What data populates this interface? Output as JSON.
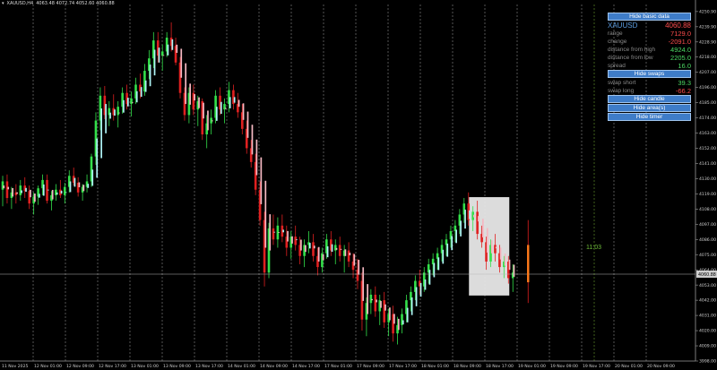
{
  "header": {
    "symbol": "XAUUSD,H4",
    "ohlc": "4063.48 4072.74 4052.60 4060.88"
  },
  "panel": {
    "hide_basic_data": "Hide basic data",
    "symbol": "XAUUSD",
    "price": "4060.88",
    "rows_basic": [
      {
        "label": "range",
        "value": "7129.0",
        "color": "#ff4d4d"
      },
      {
        "label": "change",
        "value": "-2091.0",
        "color": "#ff4d4d"
      },
      {
        "label": "distance from high",
        "value": "4924.0",
        "color": "#4cd964"
      },
      {
        "label": "distance from low",
        "value": "2205.0",
        "color": "#4cd964"
      },
      {
        "label": "spread",
        "value": "16.0",
        "color": "#4cd964"
      }
    ],
    "hide_swaps": "Hide swaps",
    "rows_swaps": [
      {
        "label": "swap short",
        "value": "39.3",
        "color": "#4cd964"
      },
      {
        "label": "swap long",
        "value": "-66.2",
        "color": "#ff4d4d"
      }
    ],
    "hide_candle": "Hide candle",
    "hide_areas": "Hide area(s)",
    "hide_timer": "Hide timer"
  },
  "timer": "11:03",
  "price_axis": {
    "labels": [
      "4250.90",
      "4239.90",
      "4228.90",
      "4218.00",
      "4207.00",
      "4196.00",
      "4185.00",
      "4174.00",
      "4163.00",
      "4152.00",
      "4141.00",
      "4130.00",
      "4119.00",
      "4108.00",
      "4097.00",
      "4086.00",
      "4075.00",
      "4064.00",
      "4053.00",
      "4042.00",
      "4031.00",
      "4020.00",
      "4009.00",
      "3998.00"
    ],
    "current_price": "4060.88",
    "current_price_color": "#cfcfcf"
  },
  "time_axis": {
    "labels": [
      "11 Nov 2025",
      "12 Nov 01:00",
      "12 Nov 09:00",
      "12 Nov 17:00",
      "13 Nov 01:00",
      "13 Nov 09:00",
      "13 Nov 17:00",
      "14 Nov 01:00",
      "14 Nov 09:00",
      "14 Nov 17:00",
      "17 Nov 01:00",
      "17 Nov 09:00",
      "17 Nov 17:00",
      "18 Nov 01:00",
      "18 Nov 09:00",
      "18 Nov 17:00",
      "19 Nov 01:00",
      "19 Nov 09:00",
      "19 Nov 17:00",
      "20 Nov 01:00",
      "20 Nov 09:00"
    ]
  },
  "colors": {
    "bull": "#33e04a",
    "bear": "#e02020",
    "ha_up": "#aef3f5",
    "ha_down": "#f5b8c2",
    "grid": "#8a8a8a",
    "highlight_box": "#e8e8e8",
    "future_bar": "#ff7a1a"
  },
  "chart_data": {
    "type": "candlestick",
    "ylim": [
      3998,
      4256
    ],
    "candles": [
      [
        4122,
        4132,
        4110,
        4128
      ],
      [
        4128,
        4133,
        4112,
        4116
      ],
      [
        4116,
        4124,
        4108,
        4120
      ],
      [
        4120,
        4126,
        4112,
        4118
      ],
      [
        4118,
        4129,
        4114,
        4125
      ],
      [
        4125,
        4131,
        4116,
        4121
      ],
      [
        4121,
        4125,
        4108,
        4112
      ],
      [
        4112,
        4120,
        4104,
        4117
      ],
      [
        4117,
        4125,
        4111,
        4123
      ],
      [
        4123,
        4133,
        4118,
        4129
      ],
      [
        4129,
        4133,
        4112,
        4114
      ],
      [
        4114,
        4121,
        4107,
        4118
      ],
      [
        4118,
        4126,
        4114,
        4122
      ],
      [
        4122,
        4129,
        4116,
        4118
      ],
      [
        4118,
        4127,
        4112,
        4124
      ],
      [
        4124,
        4136,
        4120,
        4132
      ],
      [
        4132,
        4138,
        4125,
        4127
      ],
      [
        4127,
        4131,
        4117,
        4120
      ],
      [
        4120,
        4126,
        4114,
        4124
      ],
      [
        4124,
        4133,
        4120,
        4128
      ],
      [
        4128,
        4148,
        4124,
        4146
      ],
      [
        4146,
        4178,
        4140,
        4172
      ],
      [
        4172,
        4196,
        4165,
        4190
      ],
      [
        4190,
        4197,
        4173,
        4176
      ],
      [
        4176,
        4186,
        4168,
        4181
      ],
      [
        4181,
        4191,
        4172,
        4176
      ],
      [
        4176,
        4186,
        4167,
        4182
      ],
      [
        4182,
        4196,
        4177,
        4192
      ],
      [
        4192,
        4198,
        4180,
        4184
      ],
      [
        4184,
        4193,
        4175,
        4188
      ],
      [
        4188,
        4203,
        4184,
        4198
      ],
      [
        4198,
        4206,
        4188,
        4193
      ],
      [
        4193,
        4213,
        4190,
        4208
      ],
      [
        4208,
        4223,
        4202,
        4217
      ],
      [
        4217,
        4236,
        4210,
        4230
      ],
      [
        4230,
        4236,
        4214,
        4219
      ],
      [
        4219,
        4227,
        4208,
        4222
      ],
      [
        4222,
        4236,
        4218,
        4232
      ],
      [
        4232,
        4243,
        4222,
        4226
      ],
      [
        4226,
        4232,
        4212,
        4214
      ],
      [
        4214,
        4218,
        4188,
        4192
      ],
      [
        4192,
        4196,
        4172,
        4176
      ],
      [
        4176,
        4196,
        4170,
        4192
      ],
      [
        4192,
        4198,
        4176,
        4180
      ],
      [
        4180,
        4190,
        4168,
        4186
      ],
      [
        4186,
        4188,
        4158,
        4162
      ],
      [
        4162,
        4176,
        4152,
        4170
      ],
      [
        4170,
        4180,
        4162,
        4174
      ],
      [
        4174,
        4194,
        4170,
        4190
      ],
      [
        4190,
        4196,
        4176,
        4180
      ],
      [
        4180,
        4188,
        4170,
        4184
      ],
      [
        4184,
        4200,
        4178,
        4194
      ],
      [
        4194,
        4198,
        4180,
        4184
      ],
      [
        4184,
        4192,
        4174,
        4178
      ],
      [
        4178,
        4184,
        4162,
        4166
      ],
      [
        4166,
        4172,
        4148,
        4152
      ],
      [
        4152,
        4158,
        4138,
        4142
      ],
      [
        4142,
        4148,
        4118,
        4122
      ],
      [
        4122,
        4128,
        4096,
        4100
      ],
      [
        4100,
        4106,
        4052,
        4062
      ],
      [
        4062,
        4098,
        4058,
        4094
      ],
      [
        4094,
        4104,
        4082,
        4086
      ],
      [
        4086,
        4102,
        4080,
        4096
      ],
      [
        4096,
        4104,
        4084,
        4088
      ],
      [
        4088,
        4096,
        4074,
        4080
      ],
      [
        4080,
        4092,
        4072,
        4088
      ],
      [
        4088,
        4096,
        4078,
        4082
      ],
      [
        4082,
        4088,
        4068,
        4074
      ],
      [
        4074,
        4086,
        4066,
        4082
      ],
      [
        4082,
        4092,
        4076,
        4084
      ],
      [
        4084,
        4090,
        4070,
        4074
      ],
      [
        4074,
        4080,
        4060,
        4066
      ],
      [
        4066,
        4080,
        4062,
        4076
      ],
      [
        4076,
        4090,
        4072,
        4086
      ],
      [
        4086,
        4092,
        4074,
        4078
      ],
      [
        4078,
        4086,
        4068,
        4082
      ],
      [
        4082,
        4088,
        4070,
        4074
      ],
      [
        4074,
        4082,
        4062,
        4078
      ],
      [
        4078,
        4084,
        4066,
        4070
      ],
      [
        4070,
        4076,
        4058,
        4064
      ],
      [
        4064,
        4072,
        4050,
        4056
      ],
      [
        4056,
        4062,
        4020,
        4028
      ],
      [
        4028,
        4044,
        4016,
        4040
      ],
      [
        4040,
        4050,
        4032,
        4046
      ],
      [
        4046,
        4052,
        4030,
        4034
      ],
      [
        4034,
        4046,
        4024,
        4042
      ],
      [
        4042,
        4048,
        4022,
        4026
      ],
      [
        4026,
        4036,
        4016,
        4032
      ],
      [
        4032,
        4038,
        4012,
        4018
      ],
      [
        4018,
        4030,
        4010,
        4024
      ],
      [
        4024,
        4036,
        4018,
        4032
      ],
      [
        4032,
        4046,
        4026,
        4042
      ],
      [
        4042,
        4052,
        4034,
        4048
      ],
      [
        4048,
        4060,
        4042,
        4056
      ],
      [
        4056,
        4064,
        4046,
        4052
      ],
      [
        4052,
        4066,
        4048,
        4062
      ],
      [
        4062,
        4072,
        4054,
        4068
      ],
      [
        4068,
        4076,
        4060,
        4072
      ],
      [
        4072,
        4080,
        4064,
        4076
      ],
      [
        4076,
        4086,
        4070,
        4082
      ],
      [
        4082,
        4090,
        4074,
        4086
      ],
      [
        4086,
        4096,
        4080,
        4092
      ],
      [
        4092,
        4100,
        4084,
        4096
      ],
      [
        4096,
        4108,
        4090,
        4104
      ],
      [
        4104,
        4116,
        4098,
        4112
      ],
      [
        4112,
        4120,
        4096,
        4100
      ],
      [
        4100,
        4110,
        4092,
        4106
      ],
      [
        4106,
        4114,
        4086,
        4090
      ],
      [
        4090,
        4096,
        4080,
        4084
      ],
      [
        4084,
        4088,
        4064,
        4070
      ],
      [
        4070,
        4086,
        4066,
        4082
      ],
      [
        4082,
        4090,
        4070,
        4076
      ],
      [
        4076,
        4082,
        4062,
        4066
      ],
      [
        4066,
        4074,
        4058,
        4070
      ],
      [
        4070,
        4074,
        4054,
        4058
      ],
      [
        4058,
        4068,
        4048,
        4062
      ]
    ]
  }
}
